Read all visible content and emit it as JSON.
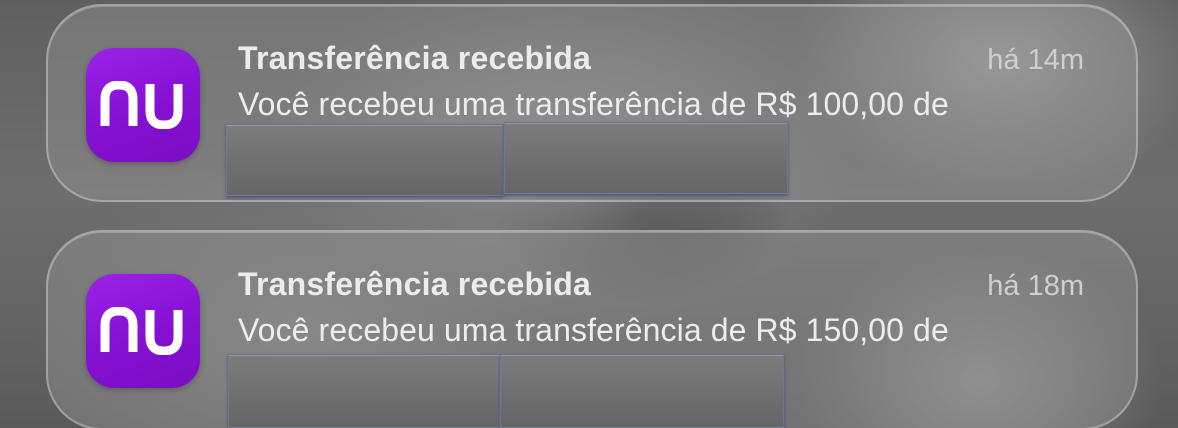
{
  "notifications": [
    {
      "app_icon": "nubank-logo-icon",
      "app_icon_text": "nu",
      "title": "Transferência recebida",
      "time": "há 14m",
      "body": "Você recebeu uma transferência de R$ 100,00 de",
      "redacted_blocks": 2
    },
    {
      "app_icon": "nubank-logo-icon",
      "app_icon_text": "nu",
      "title": "Transferência recebida",
      "time": "há 18m",
      "body": "Você recebeu uma transferência de R$ 150,00 de",
      "redacted_blocks": 2
    }
  ],
  "colors": {
    "icon_purple": "#8410d1",
    "title_text": "#ececec",
    "time_text": "#cfcfcf"
  }
}
